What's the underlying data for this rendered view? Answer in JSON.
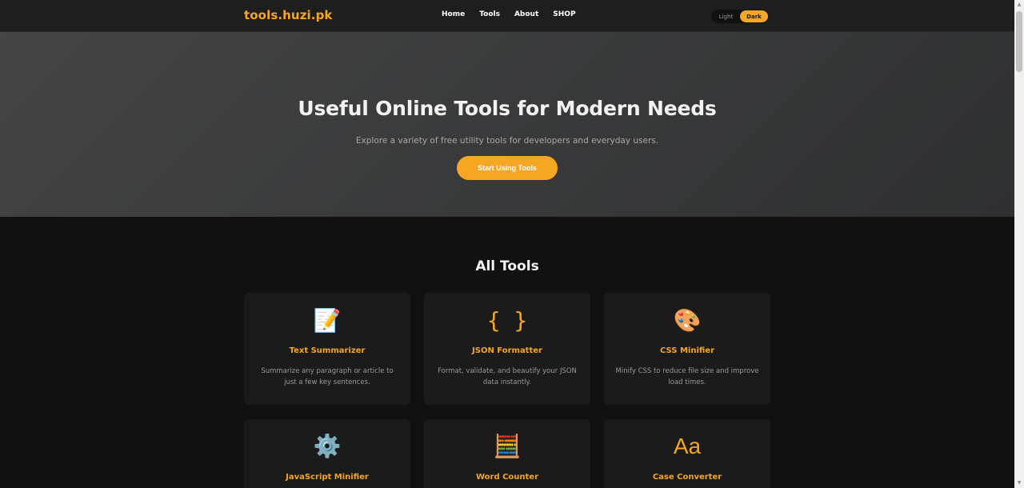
{
  "header": {
    "logo": "tools.huzi.pk",
    "nav": [
      "Home",
      "Tools",
      "About",
      "SHOP"
    ],
    "theme": {
      "light_label": "Light",
      "dark_label": "Dark",
      "selected": "Dark"
    }
  },
  "hero": {
    "title": "Useful Online Tools for Modern Needs",
    "subtitle": "Explore a variety of free utility tools for developers and everyday users.",
    "cta_label": "Start Using Tools"
  },
  "tools": {
    "section_title": "All Tools",
    "items": [
      {
        "icon": "📝",
        "icon_name": "memo-icon",
        "name": "Text Summarizer",
        "description": "Summarize any paragraph or article to just a few key sentences."
      },
      {
        "icon": "{ }",
        "icon_name": "curly-braces-icon",
        "name": "JSON Formatter",
        "description": "Format, validate, and beautify your JSON data instantly."
      },
      {
        "icon": "🎨",
        "icon_name": "palette-icon",
        "name": "CSS Minifier",
        "description": "Minify CSS to reduce file size and improve load times."
      },
      {
        "icon": "⚙️",
        "icon_name": "gear-icon",
        "name": "JavaScript Minifier",
        "description": ""
      },
      {
        "icon": "🧮",
        "icon_name": "abacus-icon",
        "name": "Word Counter",
        "description": ""
      },
      {
        "icon": "Aa",
        "icon_name": "case-aa-icon",
        "name": "Case Converter",
        "description": ""
      }
    ]
  },
  "colors": {
    "accent": "#f5a623",
    "background": "#111111",
    "card": "#1b1b1b",
    "header": "#1e1e1e"
  }
}
